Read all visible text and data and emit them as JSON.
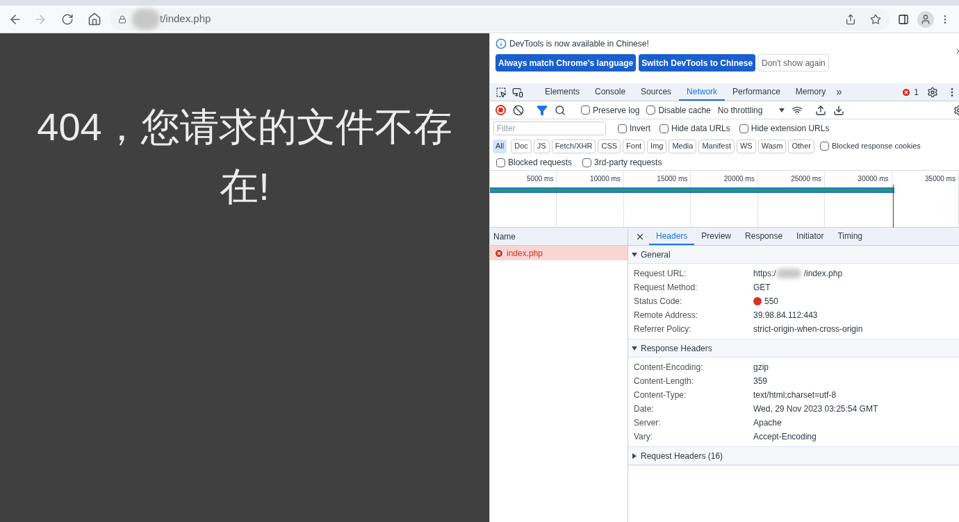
{
  "browser": {
    "address": "t/index.php"
  },
  "page": {
    "message": "404，您请求的文件不存在!"
  },
  "devtools": {
    "infobar": {
      "text": "DevTools is now available in Chinese!",
      "buttons": [
        {
          "label": "Always match Chrome's language",
          "kind": "primary"
        },
        {
          "label": "Switch DevTools to Chinese",
          "kind": "primary"
        },
        {
          "label": "Don't show again",
          "kind": "secondary"
        }
      ]
    },
    "tabs": [
      {
        "label": "Elements",
        "selected": false
      },
      {
        "label": "Console",
        "selected": false
      },
      {
        "label": "Sources",
        "selected": false
      },
      {
        "label": "Network",
        "selected": true
      },
      {
        "label": "Performance",
        "selected": false
      },
      {
        "label": "Memory",
        "selected": false
      }
    ],
    "more_tabs": "»",
    "error_count": "1",
    "toolbar": {
      "preserve_log": {
        "label": "Preserve log",
        "checked": false
      },
      "disable_cache": {
        "label": "Disable cache",
        "checked": false
      },
      "throttling": "No throttling"
    },
    "filter": {
      "placeholder": "Filter",
      "options": [
        {
          "label": "Invert",
          "checked": false
        },
        {
          "label": "Hide data URLs",
          "checked": false
        },
        {
          "label": "Hide extension URLs",
          "checked": false
        }
      ]
    },
    "types": [
      {
        "label": "All",
        "selected": true
      },
      {
        "label": "Doc",
        "selected": false
      },
      {
        "label": "JS",
        "selected": false
      },
      {
        "label": "Fetch/XHR",
        "selected": false
      },
      {
        "label": "CSS",
        "selected": false
      },
      {
        "label": "Font",
        "selected": false
      },
      {
        "label": "Img",
        "selected": false
      },
      {
        "label": "Media",
        "selected": false
      },
      {
        "label": "Manifest",
        "selected": false
      },
      {
        "label": "WS",
        "selected": false
      },
      {
        "label": "Wasm",
        "selected": false
      },
      {
        "label": "Other",
        "selected": false
      }
    ],
    "blocked_cookies": {
      "label": "Blocked response cookies",
      "checked": false
    },
    "extra_filters": [
      {
        "label": "Blocked requests",
        "checked": false
      },
      {
        "label": "3rd-party requests",
        "checked": false
      }
    ],
    "timeline": {
      "ticks": [
        "5000 ms",
        "10000 ms",
        "15000 ms",
        "20000 ms",
        "25000 ms",
        "30000 ms",
        "35000 ms"
      ]
    },
    "requests": {
      "column": "Name",
      "rows": [
        {
          "name": "index.php",
          "selected": true,
          "failed": true
        }
      ]
    },
    "detail_tabs": [
      {
        "label": "Headers",
        "selected": true
      },
      {
        "label": "Preview",
        "selected": false
      },
      {
        "label": "Response",
        "selected": false
      },
      {
        "label": "Initiator",
        "selected": false
      },
      {
        "label": "Timing",
        "selected": false
      }
    ],
    "sections": [
      {
        "title": "General",
        "expanded": true,
        "rows": [
          {
            "key": "Request URL:",
            "value_prefix": "https:/",
            "value": "/index.php",
            "redacted": true
          },
          {
            "key": "Request Method:",
            "value": "GET"
          },
          {
            "key": "Status Code:",
            "value": "550",
            "color": "#d93025"
          },
          {
            "key": "Remote Address:",
            "value": "39.98.84.112:443"
          },
          {
            "key": "Referrer Policy:",
            "value": "strict-origin-when-cross-origin"
          }
        ]
      },
      {
        "title": "Response Headers",
        "expanded": true,
        "rows": [
          {
            "key": "Content-Encoding:",
            "value": "gzip"
          },
          {
            "key": "Content-Length:",
            "value": "359"
          },
          {
            "key": "Content-Type:",
            "value": "text/html;charset=utf-8"
          },
          {
            "key": "Date:",
            "value": "Wed, 29 Nov 2023 03:25:54 GMT"
          },
          {
            "key": "Server:",
            "value": "Apache"
          },
          {
            "key": "Vary:",
            "value": "Accept-Encoding"
          }
        ]
      },
      {
        "title": "Request Headers (16)",
        "expanded": false
      }
    ]
  }
}
